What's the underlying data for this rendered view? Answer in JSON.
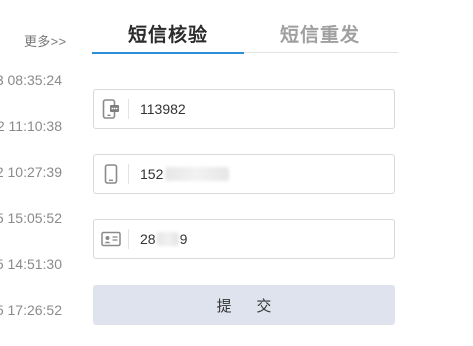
{
  "left_panel": {
    "more_label": "更多>>",
    "times": [
      "3 08:35:24",
      "2 11:10:38",
      "2 10:27:39",
      "5 15:05:52",
      "5 14:51:30",
      "5 17:26:52"
    ]
  },
  "tabs": [
    {
      "label": "短信核验",
      "active": true
    },
    {
      "label": "短信重发",
      "active": false
    }
  ],
  "fields": {
    "sms_code": {
      "icon": "phone-message-icon",
      "value": "113982"
    },
    "phone": {
      "icon": "mobile-phone-icon",
      "value": "152"
    },
    "id_card": {
      "icon": "id-card-icon",
      "value_prefix": "28",
      "value_suffix": "9"
    }
  },
  "submit_label": "提 交",
  "colors": {
    "active_tab_underline": "#2a8fd6",
    "submit_bg": "#dee3ee",
    "inactive_tab": "#a0a0a0"
  }
}
